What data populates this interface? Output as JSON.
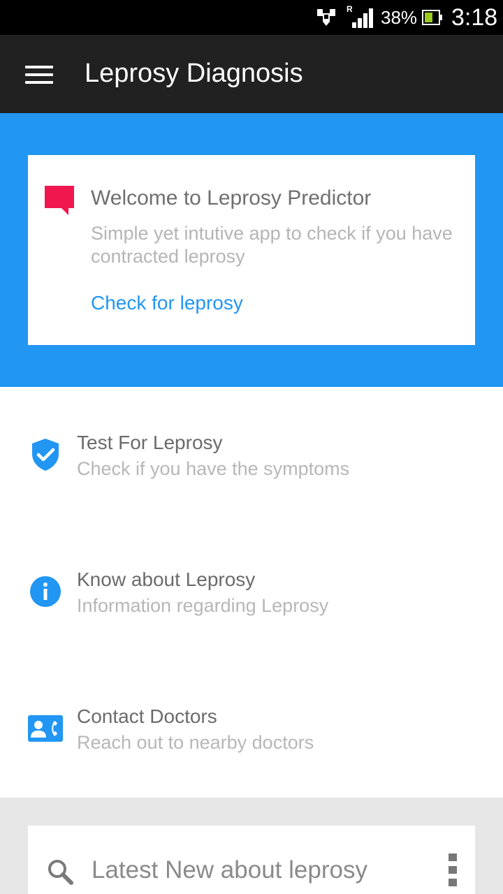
{
  "status_bar": {
    "roaming": "R",
    "battery_percent": "38%",
    "time": "3:18"
  },
  "app_bar": {
    "title": "Leprosy Diagnosis",
    "menu_icon": "hamburger-menu-icon"
  },
  "welcome_card": {
    "icon": "chat-bubble-icon",
    "icon_color": "#F0174F",
    "title": "Welcome to Leprosy Predictor",
    "description": "Simple yet intutive app to check if  you have contracted leprosy",
    "link_label": "Check for leprosy"
  },
  "menu": {
    "items": [
      {
        "icon": "shield-check-icon",
        "title": "Test For Leprosy",
        "subtitle": "Check if you have the symptoms"
      },
      {
        "icon": "info-icon",
        "title": "Know about Leprosy",
        "subtitle": "Information regarding Leprosy"
      },
      {
        "icon": "contact-phone-icon",
        "title": "Contact Doctors",
        "subtitle": "Reach out to nearby doctors"
      }
    ]
  },
  "news": {
    "icon": "search-icon",
    "title": "Latest New about leprosy",
    "menu_icon": "more-vertical-icon"
  },
  "colors": {
    "accent": "#2196F3",
    "app_bar": "#212121",
    "status_bar": "#000000",
    "news_background": "#E6E6E6"
  }
}
